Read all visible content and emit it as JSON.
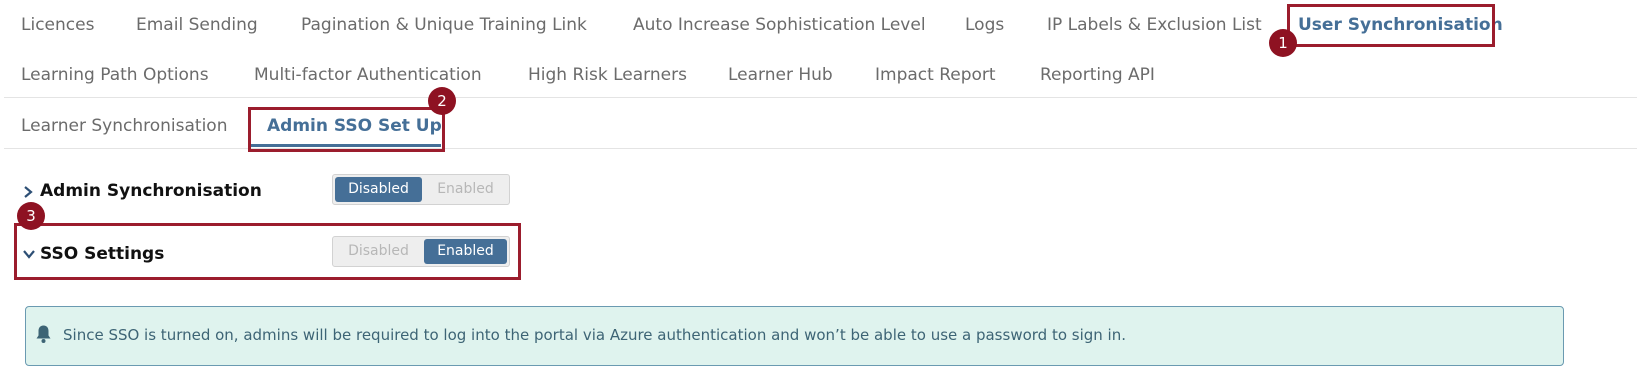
{
  "tabs_row1": [
    {
      "label": "Licences"
    },
    {
      "label": "Email Sending"
    },
    {
      "label": "Pagination & Unique Training Link"
    },
    {
      "label": "Auto Increase Sophistication Level"
    },
    {
      "label": "Logs"
    },
    {
      "label": "IP Labels & Exclusion List"
    },
    {
      "label": "User Synchronisation",
      "active": true
    }
  ],
  "tabs_row2": [
    {
      "label": "Learning Path Options"
    },
    {
      "label": "Multi-factor Authentication"
    },
    {
      "label": "High Risk Learners"
    },
    {
      "label": "Learner Hub"
    },
    {
      "label": "Impact Report"
    },
    {
      "label": "Reporting API"
    }
  ],
  "subtabs": [
    {
      "label": "Learner Synchronisation"
    },
    {
      "label": "Admin SSO Set Up",
      "active": true
    }
  ],
  "sections": {
    "admin_sync": {
      "title": "Admin Synchronisation",
      "expanded": false,
      "toggle": {
        "off": "Disabled",
        "on": "Enabled",
        "value": "Disabled"
      }
    },
    "sso": {
      "title": "SSO Settings",
      "expanded": true,
      "toggle": {
        "off": "Disabled",
        "on": "Enabled",
        "value": "Enabled"
      }
    }
  },
  "alert": {
    "icon": "bell-icon",
    "text": "Since SSO is turned on, admins will be required to log into the portal via Azure authentication and won’t be able to use a password to sign in."
  },
  "annotations": [
    {
      "number": "1"
    },
    {
      "number": "2"
    },
    {
      "number": "3"
    }
  ],
  "colors": {
    "accent": "#456f97",
    "callout": "#9b1d2d",
    "badge": "#8e1222",
    "alert_bg": "#dff3ee"
  }
}
